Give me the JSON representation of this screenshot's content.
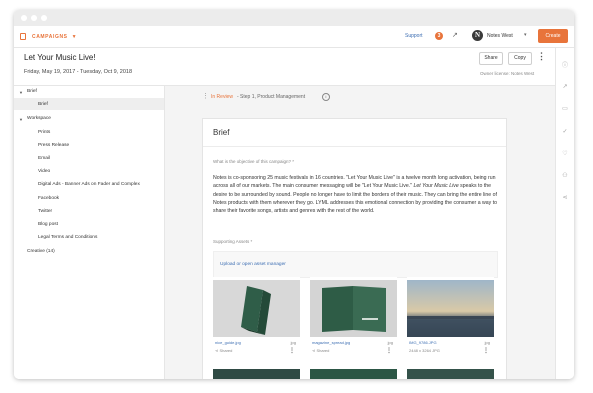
{
  "app": {
    "section_label": "CAMPAIGNS",
    "support_label": "Support",
    "notification_count": "3",
    "user_initial": "N",
    "user_name": "Notes West",
    "create_label": "Create"
  },
  "campaign": {
    "title": "Let Your Music Live!",
    "dates": "Friday, May 19, 2017 - Tuesday, Oct 9, 2018",
    "share_label": "Share",
    "copy_label": "Copy",
    "owner_text": "Owner license: Notes West"
  },
  "sidebar": {
    "items": [
      {
        "label": "Brief"
      },
      {
        "label": "Brief"
      },
      {
        "label": "Workspace"
      },
      {
        "label": "Prints"
      },
      {
        "label": "Press Release"
      },
      {
        "label": "Email"
      },
      {
        "label": "Video"
      },
      {
        "label": "Digital Ads - Banner Ads on Fader and Complex"
      },
      {
        "label": "Facebook"
      },
      {
        "label": "Twitter"
      },
      {
        "label": "Blog post"
      },
      {
        "label": "Legal Terms and Conditions"
      },
      {
        "label": "Creative (14)"
      }
    ]
  },
  "breadcrumb": {
    "status": "In Review",
    "text": "- Step 1, Product Management"
  },
  "brief": {
    "title": "Brief",
    "question": "What is the objective of this campaign? *",
    "answer_part1": "Notes is co-sponsoring 25 music festivals in 16 countries. \"Let Your Music Live\" is a twelve month long activation, being run across all of our markets. The main consumer messaging will be \"Let Your Music Live.\"",
    "answer_italic": "Let Your Music Live",
    "answer_part2": "speaks to the desire to be surrounded by sound. People no longer have to limit the borders of their music. They can bring the entire line of Notes products with them wherever they go. LYML addresses this emotional connection by providing the consumer a way to share their favorite songs, artists and genres with the rest of the world.",
    "assets_label": "Supporting Assets *",
    "upload_label": "Upload or open asset manager"
  },
  "assets": [
    {
      "name": "nice_guide.jpg",
      "type": "jpg",
      "sub": "Shared"
    },
    {
      "name": "magazine_spread.jpg",
      "type": "jpg",
      "sub": "Shared"
    },
    {
      "name": "IMG_9786.JPG",
      "type": "jpg",
      "sub": "2448 x 3264 JPG"
    }
  ],
  "colors": {
    "accent": "#e8743b",
    "link": "#3e6fb3"
  }
}
